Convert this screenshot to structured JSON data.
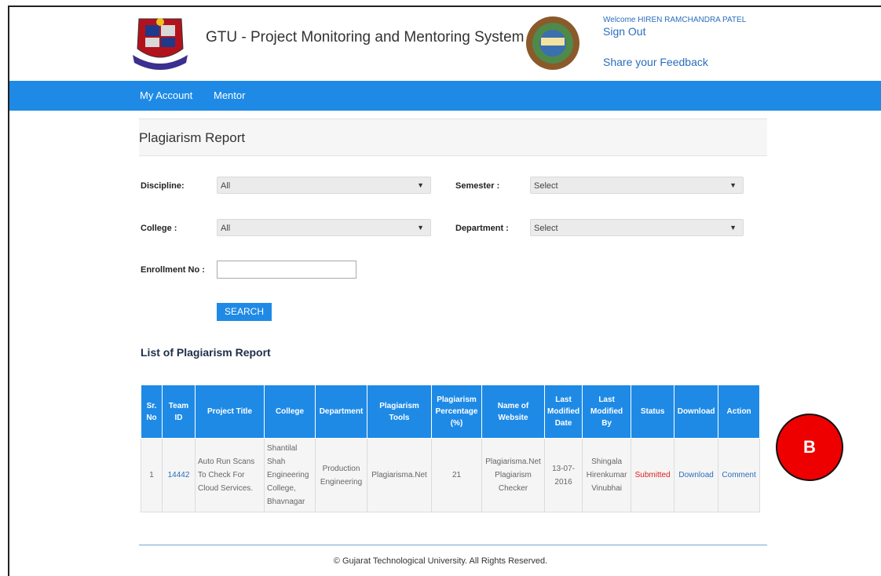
{
  "header": {
    "title": "GTU - Project Monitoring and Mentoring System",
    "welcome": "Welcome HIREN RAMCHANDRA PATEL",
    "sign_out": "Sign Out",
    "feedback": "Share your Feedback"
  },
  "nav": {
    "items": [
      "My Account",
      "Mentor"
    ]
  },
  "page": {
    "title": "Plagiarism Report"
  },
  "filters": {
    "discipline_label": "Discipline:",
    "discipline_value": "All",
    "semester_label": "Semester :",
    "semester_value": "Select",
    "college_label": "College :",
    "college_value": "All",
    "department_label": "Department :",
    "department_value": "Select",
    "enrollment_label": "Enrollment No :",
    "enrollment_value": "",
    "search_button": "SEARCH"
  },
  "list": {
    "heading": "List of Plagiarism Report",
    "columns": [
      "Sr. No",
      "Team ID",
      "Project Title",
      "College",
      "Department",
      "Plagiarism Tools",
      "Plagiarism Percentage (%)",
      "Name of Website",
      "Last Modified Date",
      "Last Modified By",
      "Status",
      "Download",
      "Action"
    ],
    "rows": [
      {
        "sr_no": "1",
        "team_id": "14442",
        "project_title": "Auto Run Scans To Check For Cloud Services.",
        "college": "Shantilal Shah Engineering College, Bhavnagar",
        "department": "Production Engineering",
        "tool": "Plagiarisma.Net",
        "percentage": "21",
        "website": "Plagiarisma.Net Plagiarism Checker",
        "modified_date": "13-07-2016",
        "modified_by": "Shingala Hirenkumar Vinubhai",
        "status": "Submitted",
        "download": "Download",
        "action": "Comment"
      }
    ]
  },
  "badge": {
    "label": "B"
  },
  "footer": {
    "text": "© Gujarat Technological University. All Rights Reserved."
  },
  "colors": {
    "nav_bg": "#1e8ae6",
    "link": "#2a6ebb",
    "status_red": "#e02020",
    "badge": "#ee0000"
  },
  "icons": [
    "gtu-logo-icon",
    "globe-emblem-icon",
    "caret-down-icon"
  ]
}
